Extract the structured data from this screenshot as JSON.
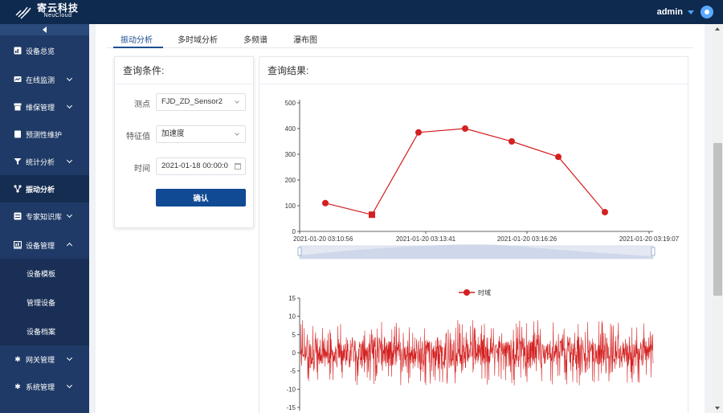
{
  "app": {
    "brand_cn": "寄云科技",
    "brand_en": "NeuCloud"
  },
  "user": {
    "name": "admin"
  },
  "sidebar": {
    "items": [
      {
        "label": "设备总览",
        "icon": "dashboard-icon"
      },
      {
        "label": "在线监测",
        "icon": "monitor-icon"
      },
      {
        "label": "维保管理",
        "icon": "maintenance-icon"
      },
      {
        "label": "预测性维护",
        "icon": "predictive-icon"
      },
      {
        "label": "统计分析",
        "icon": "filter-icon"
      },
      {
        "label": "振动分析",
        "icon": "vibration-icon"
      },
      {
        "label": "专家知识库",
        "icon": "knowledge-icon"
      },
      {
        "label": "设备管理",
        "icon": "device-icon"
      },
      {
        "label": "网关管理",
        "icon": "gear-icon"
      },
      {
        "label": "系统管理",
        "icon": "gear-icon"
      }
    ],
    "submenu": [
      "设备模板",
      "管理设备",
      "设备档案"
    ]
  },
  "tabs": [
    "振动分析",
    "多时域分析",
    "多频谱",
    "瀑布图"
  ],
  "query": {
    "title": "查询条件:",
    "point_label": "测点",
    "point_value": "FJD_ZD_Sensor2",
    "feature_label": "特征值",
    "feature_value": "加速度",
    "time_label": "时间",
    "time_value": "2021-01-18 00:00:0",
    "confirm": "确认"
  },
  "result": {
    "title": "查询结果:"
  },
  "chart_data": [
    {
      "type": "line",
      "title": "",
      "x": [
        "2021-01-20 03:10:56",
        "2021-01-20 03:12:05",
        "2021-01-20 03:13:13",
        "2021-01-20 03:14:21",
        "2021-01-20 03:15:36",
        "2021-01-20 03:17:26",
        "2021-01-20 03:19:07"
      ],
      "xticks": [
        "2021-01-20 03:10:56",
        "2021-01-20 03:13:41",
        "2021-01-20 03:16:26",
        "2021-01-20 03:19:07"
      ],
      "series": [
        {
          "name": "",
          "values": [
            110,
            65,
            385,
            400,
            350,
            290,
            75
          ]
        }
      ],
      "ylim": [
        0,
        500
      ],
      "yticks": [
        0,
        100,
        200,
        300,
        400,
        500
      ],
      "color": "#d42020",
      "zoom_slider": true
    },
    {
      "type": "line",
      "title": "",
      "legend": "top-center",
      "series": [
        {
          "name": "时域"
        }
      ],
      "ylim": [
        -15,
        15
      ],
      "yticks": [
        15,
        10,
        5,
        0,
        -5,
        -10,
        -15
      ],
      "color": "#d42020",
      "note": "dense oscillating waveform roughly between -8 and 9"
    }
  ]
}
